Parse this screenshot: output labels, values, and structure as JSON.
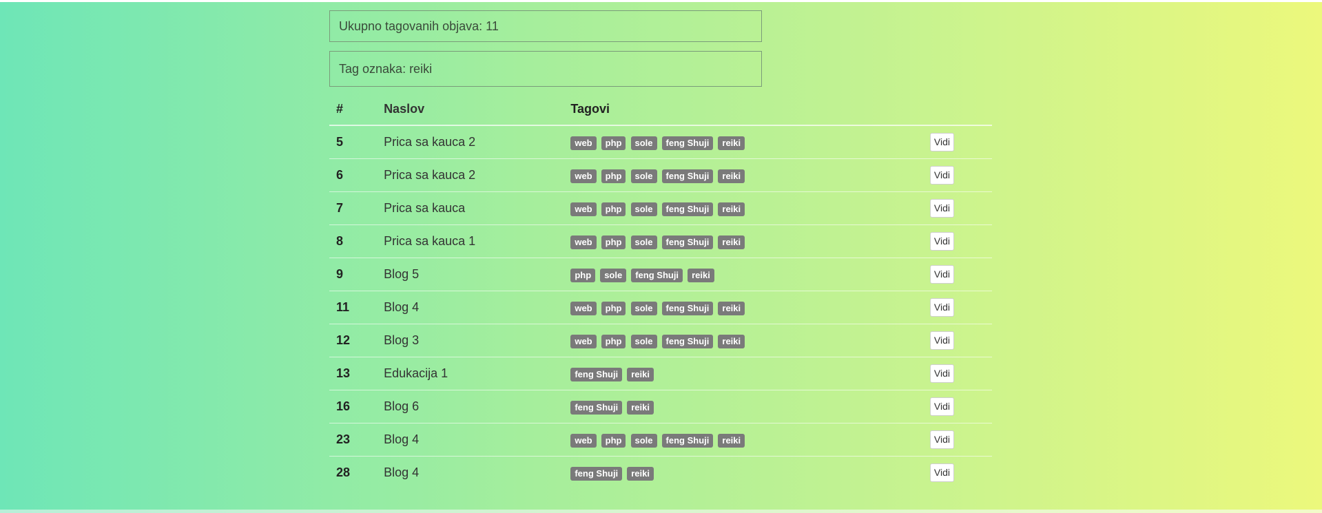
{
  "summary": {
    "total_label": "Ukupno tagovanih objava: 11",
    "tag_label": "Tag oznaka: reiki"
  },
  "table": {
    "headers": [
      "#",
      "Naslov",
      "Tagovi",
      ""
    ],
    "action_label": "Vidi",
    "rows": [
      {
        "id": "5",
        "title": "Prica sa kauca 2",
        "tags": [
          "web",
          "php",
          "sole",
          "feng Shuji",
          "reiki"
        ]
      },
      {
        "id": "6",
        "title": "Prica sa kauca 2",
        "tags": [
          "web",
          "php",
          "sole",
          "feng Shuji",
          "reiki"
        ]
      },
      {
        "id": "7",
        "title": "Prica sa kauca",
        "tags": [
          "web",
          "php",
          "sole",
          "feng Shuji",
          "reiki"
        ]
      },
      {
        "id": "8",
        "title": "Prica sa kauca 1",
        "tags": [
          "web",
          "php",
          "sole",
          "feng Shuji",
          "reiki"
        ]
      },
      {
        "id": "9",
        "title": "Blog 5",
        "tags": [
          "php",
          "sole",
          "feng Shuji",
          "reiki"
        ]
      },
      {
        "id": "11",
        "title": "Blog 4",
        "tags": [
          "web",
          "php",
          "sole",
          "feng Shuji",
          "reiki"
        ]
      },
      {
        "id": "12",
        "title": "Blog 3",
        "tags": [
          "web",
          "php",
          "sole",
          "feng Shuji",
          "reiki"
        ]
      },
      {
        "id": "13",
        "title": "Edukacija 1",
        "tags": [
          "feng Shuji",
          "reiki"
        ]
      },
      {
        "id": "16",
        "title": "Blog 6",
        "tags": [
          "feng Shuji",
          "reiki"
        ]
      },
      {
        "id": "23",
        "title": "Blog 4",
        "tags": [
          "web",
          "php",
          "sole",
          "feng Shuji",
          "reiki"
        ]
      },
      {
        "id": "28",
        "title": "Blog 4",
        "tags": [
          "feng Shuji",
          "reiki"
        ]
      }
    ]
  },
  "colors": {
    "gradient_start": "#6ee6b7",
    "gradient_end": "#ecf87c",
    "tag_badge": "#7a7a7a"
  }
}
